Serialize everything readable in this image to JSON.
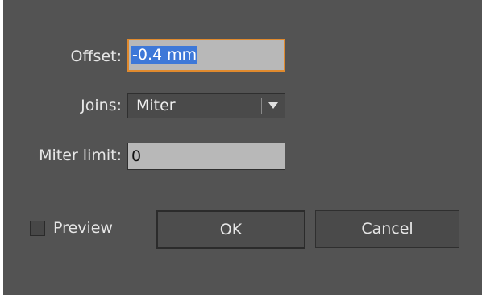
{
  "offset": {
    "label": "Offset:",
    "value": "-0.4 mm"
  },
  "joins": {
    "label": "Joins:",
    "value": "Miter"
  },
  "miter_limit": {
    "label": "Miter limit:",
    "value": "0"
  },
  "preview": {
    "label": "Preview",
    "checked": false
  },
  "buttons": {
    "ok_label": "OK",
    "cancel_label": "Cancel"
  },
  "colors": {
    "dialog_bg": "#535353",
    "focus_ring": "#e08a2e",
    "selection": "#3d78d8"
  }
}
